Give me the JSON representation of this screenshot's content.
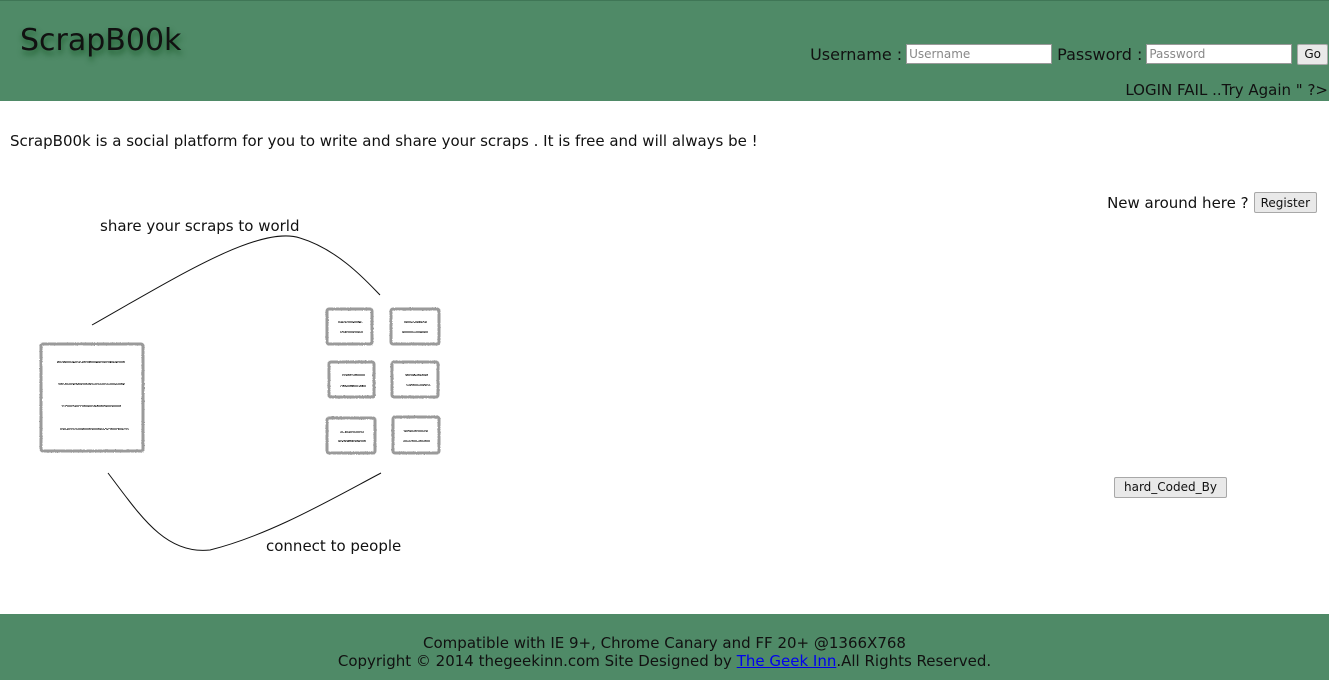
{
  "header": {
    "logo": "ScrapB00k",
    "username_label": "Username :",
    "username_placeholder": "Username",
    "password_label": "Password :",
    "password_placeholder": "Password",
    "go_label": "Go",
    "login_fail": "LOGIN FAIL ..Try Again \" ?>"
  },
  "main": {
    "intro": "ScrapB00k is a social platform for you to write and share your scraps . It is free and will always be !",
    "new_around": "New around here ?",
    "register_label": "Register",
    "hardcoded_label": "hard_Coded_By",
    "diagram": {
      "top_caption": "share your scraps to world",
      "bottom_caption": "connect to people"
    }
  },
  "footer": {
    "line1": "Compatible with IE 9+, Chrome Canary and FF 20+ @1366X768",
    "line2_prefix": "Copyright © 2014 thegeekinn.com Site Designed by ",
    "link_text": "The Geek Inn",
    "line2_suffix": ".All Rights Reserved."
  },
  "colors": {
    "header_bg": "#4f8a67",
    "footer_bg": "#4f8a67"
  }
}
